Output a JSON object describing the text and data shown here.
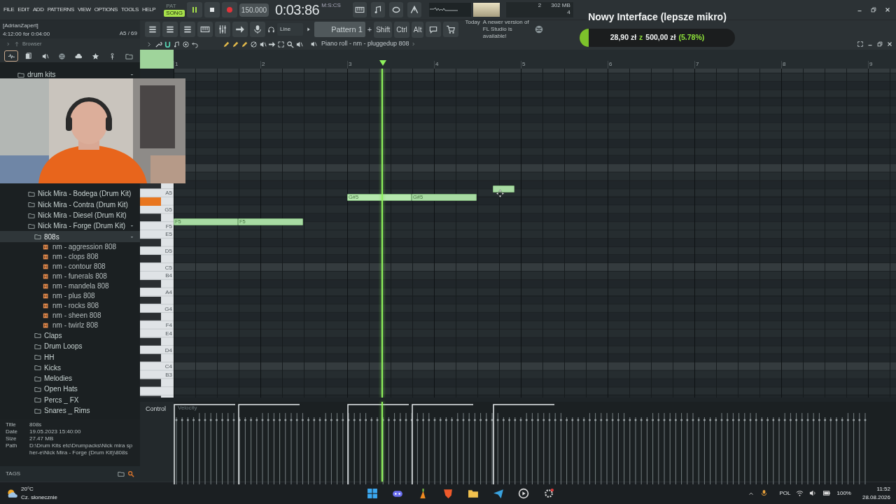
{
  "menu": [
    "FILE",
    "EDIT",
    "ADD",
    "PATTERNS",
    "VIEW",
    "OPTIONS",
    "TOOLS",
    "HELP"
  ],
  "transport": {
    "modes": [
      {
        "label": "PAT",
        "selected": false
      },
      {
        "label": "SONG",
        "selected": true
      }
    ],
    "playing": true,
    "tempo": "150.000",
    "time": "0:03:86",
    "time_unit": "M:S:CS"
  },
  "monitor": {
    "cpu": "2",
    "memory": "302 MB",
    "polyphony": "4"
  },
  "hint": {
    "user": "[AdrianZapert]",
    "text": "4:12:00 for 0:04:00",
    "position": "A5 / 69"
  },
  "toolbar": {
    "snap": "Line",
    "pattern": "Pattern 1",
    "plus": "+",
    "modifiers": [
      "Shift",
      "Ctrl",
      "Alt"
    ],
    "news_day": "Today",
    "news": "A newer version of FL Studio is available!"
  },
  "browser": {
    "title": "Browser",
    "tabs": [
      {
        "selected": true
      },
      {
        "selected": false
      },
      {
        "selected": false
      },
      {
        "selected": false
      },
      {
        "selected": false
      },
      {
        "selected": false
      },
      {
        "selected": false
      },
      {
        "selected": false
      }
    ],
    "tree": [
      {
        "label": "drum kits",
        "kind": "folder",
        "expanded": true,
        "selected": false,
        "children": [
          {
            "label": "Nick Mira - Bodega (Drum Kit)",
            "kind": "folder",
            "expanded": false,
            "selected": false
          },
          {
            "label": "Nick Mira - Contra (Drum Kit)",
            "kind": "folder",
            "expanded": false,
            "selected": false
          },
          {
            "label": "Nick Mira - Diesel (Drum Kit)",
            "kind": "folder",
            "expanded": false,
            "selected": false
          },
          {
            "label": "Nick Mira - Forge (Drum Kit)",
            "kind": "folder",
            "expanded": true,
            "selected": false,
            "children": [
              {
                "label": "808s",
                "kind": "folder",
                "expanded": true,
                "selected": true,
                "children": [
                  {
                    "label": "nm - aggression 808",
                    "kind": "file",
                    "selected": false
                  },
                  {
                    "label": "nm - clops 808",
                    "kind": "file",
                    "selected": false
                  },
                  {
                    "label": "nm - contour 808",
                    "kind": "file",
                    "selected": false
                  },
                  {
                    "label": "nm - funerals 808",
                    "kind": "file",
                    "selected": false
                  },
                  {
                    "label": "nm - mandela 808",
                    "kind": "file",
                    "selected": false
                  },
                  {
                    "label": "nm - plus 808",
                    "kind": "file",
                    "selected": false
                  },
                  {
                    "label": "nm - rocks 808",
                    "kind": "file",
                    "selected": false
                  },
                  {
                    "label": "nm - sheen 808",
                    "kind": "file",
                    "selected": false
                  },
                  {
                    "label": "nm - twirlz 808",
                    "kind": "file",
                    "selected": false
                  }
                ]
              },
              {
                "label": "Claps",
                "kind": "folder",
                "expanded": false,
                "selected": false
              },
              {
                "label": "Drum Loops",
                "kind": "folder",
                "expanded": false,
                "selected": false
              },
              {
                "label": "HH",
                "kind": "folder",
                "expanded": false,
                "selected": false
              },
              {
                "label": "Kicks",
                "kind": "folder",
                "expanded": false,
                "selected": false
              },
              {
                "label": "Melodies",
                "kind": "folder",
                "expanded": false,
                "selected": false
              },
              {
                "label": "Open Hats",
                "kind": "folder",
                "expanded": false,
                "selected": false
              },
              {
                "label": "Percs _ FX",
                "kind": "folder",
                "expanded": false,
                "selected": false
              },
              {
                "label": "Snares _ Rims",
                "kind": "folder",
                "expanded": false,
                "selected": false
              }
            ]
          }
        ]
      }
    ],
    "info": [
      {
        "label": "Title",
        "value": "808s"
      },
      {
        "label": "Date",
        "value": "19.05.2023 15:40:00"
      },
      {
        "label": "Size",
        "value": "27.47 MB"
      },
      {
        "label": "Path",
        "value": "D:\\Drum Kits etc\\Drumpacks\\Nick mira spher-e\\Nick Mira - Forge (Drum Kit)\\808s"
      }
    ],
    "tags_label": "TAGS"
  },
  "piano_roll": {
    "title": "Piano roll - nm - pluggedup 808",
    "ruler": [
      "1",
      "2",
      "3",
      "4",
      "5",
      "6",
      "7",
      "8",
      "9"
    ],
    "keys": [
      "A5",
      "G5",
      "F5",
      "E5",
      "D5",
      "C5",
      "B4",
      "A4",
      "G4",
      "F4",
      "E4",
      "D4",
      "C4",
      "B3"
    ],
    "notes": [
      {
        "label": "F5",
        "playing": false
      },
      {
        "label": "F5",
        "playing": false
      },
      {
        "label": "G#5",
        "playing": true
      },
      {
        "label": "G#5",
        "playing": false
      },
      {
        "playing": false
      }
    ],
    "control_label": "Control",
    "control_target": "Velocity"
  },
  "donation": {
    "title": "Nowy Interface (lepsze mikro)",
    "level": 0.0578,
    "raised": "28,90 zł",
    "separator": "z",
    "goal": "500,00 zł",
    "percent": "(5.78%)"
  },
  "taskbar": {
    "temperature": "20°C",
    "weather": "Cz. słonecznie",
    "language": "POL",
    "battery": "100%",
    "time": "11:52",
    "date": "28.08.2026"
  }
}
